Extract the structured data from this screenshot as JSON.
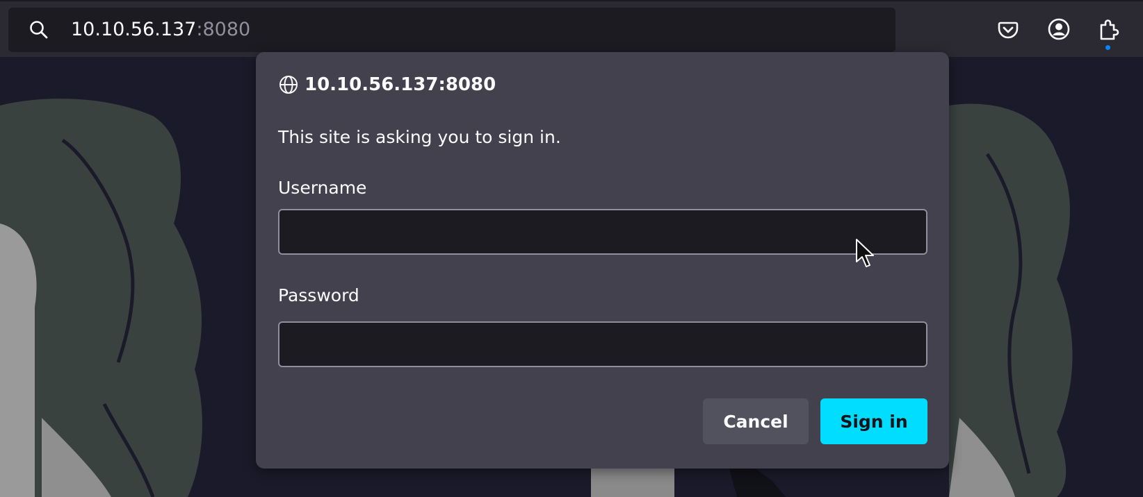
{
  "toolbar": {
    "url_host": "10.10.56.137",
    "url_port": ":8080",
    "icons": [
      "search-icon",
      "pocket-icon",
      "account-icon",
      "extensions-icon"
    ]
  },
  "dialog": {
    "site": "10.10.56.137:8080",
    "message": "This site is asking you to sign in.",
    "username_label": "Username",
    "username_value": "",
    "password_label": "Password",
    "password_value": "",
    "cancel_label": "Cancel",
    "signin_label": "Sign in"
  },
  "colors": {
    "dialog_bg": "#42414d",
    "toolbar_bg": "#2b2a33",
    "field_bg": "#1c1b22",
    "primary_button": "#00ddff",
    "secondary_button": "#52515e"
  }
}
